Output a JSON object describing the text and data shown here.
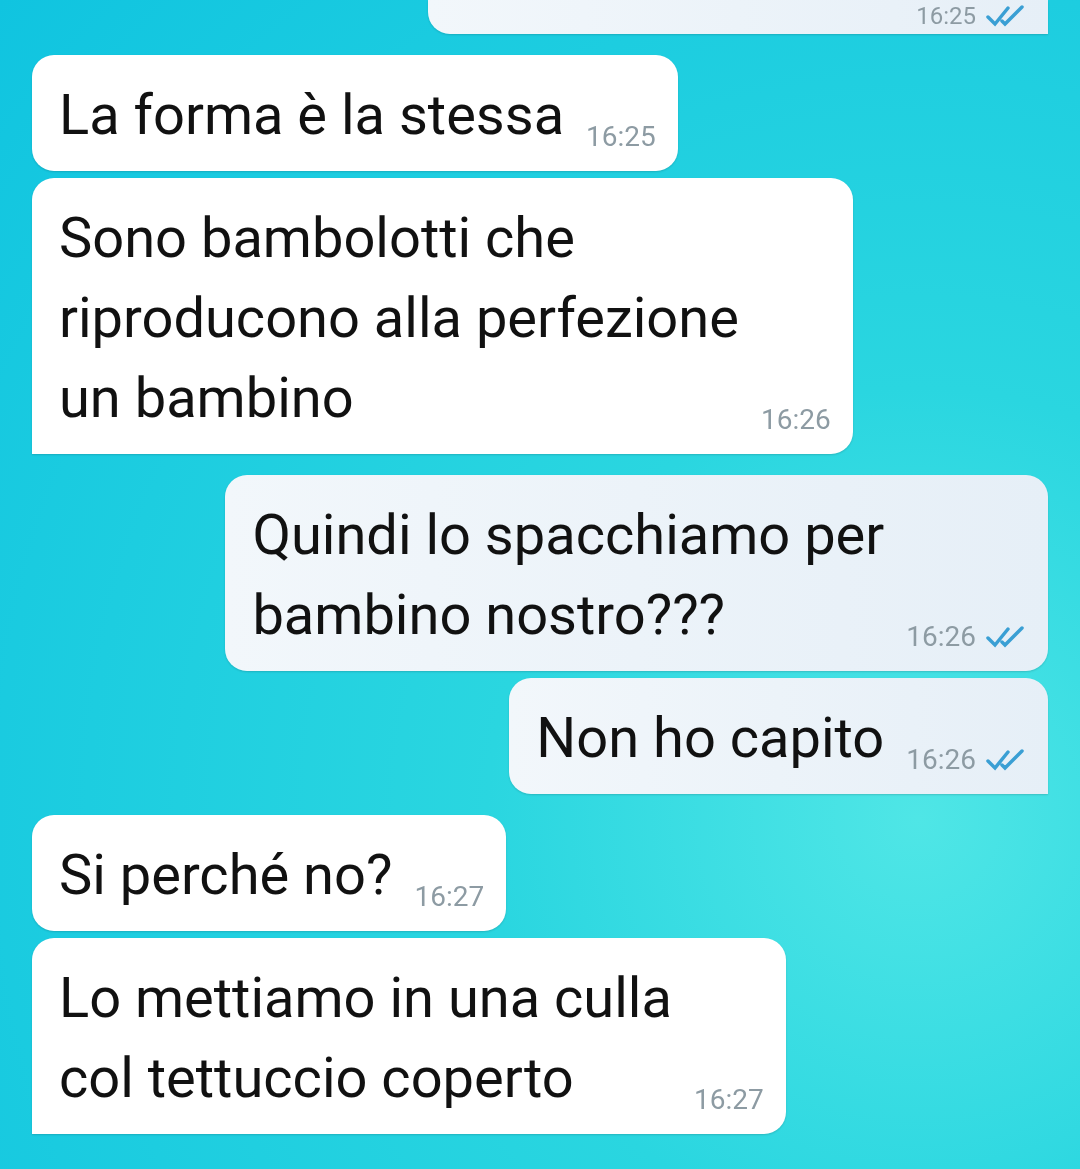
{
  "messages": [
    {
      "kind": "outgoing",
      "time": "16:25",
      "read": true,
      "tail": true
    },
    {
      "kind": "incoming",
      "text": "La forma è la stessa",
      "time": "16:25",
      "tail": false
    },
    {
      "kind": "incoming",
      "text": "Sono bambolotti che\nriproducono alla perfezione\nun bambino",
      "time": "16:26",
      "tail": true
    },
    {
      "kind": "outgoing",
      "text": "Quindi lo spacchiamo per\nbambino nostro???",
      "time": "16:26",
      "read": true,
      "tail": false
    },
    {
      "kind": "outgoing",
      "text": "Non ho capito",
      "time": "16:26",
      "read": true,
      "tail": true
    },
    {
      "kind": "incoming",
      "text": "Si perché no?",
      "time": "16:27",
      "tail": false
    },
    {
      "kind": "incoming",
      "text": "Lo mettiamo in una culla\ncol tettuccio coperto",
      "time": "16:27",
      "tail": true
    }
  ]
}
